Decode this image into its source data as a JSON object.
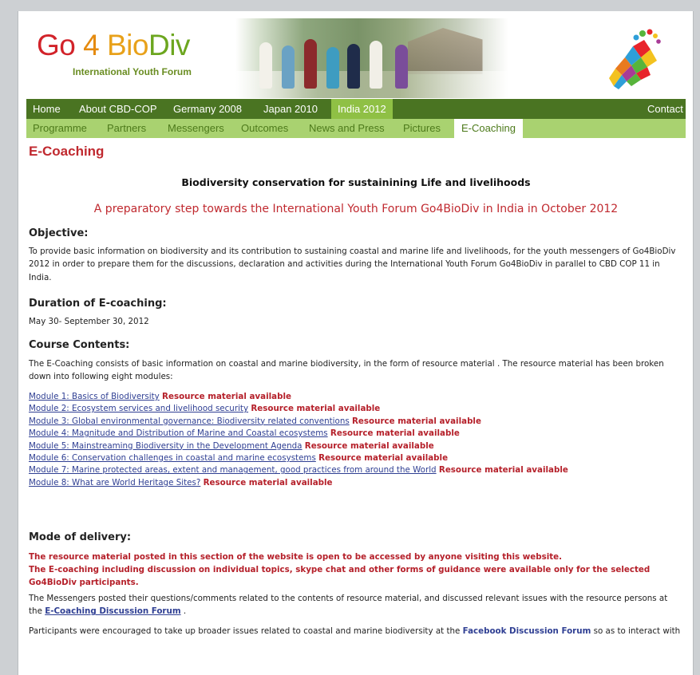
{
  "header": {
    "logo": {
      "go": "Go",
      "four": "4",
      "bio": "Bio",
      "div": "Div"
    },
    "tagline": "International Youth Forum"
  },
  "nav_primary": [
    {
      "label": "Home"
    },
    {
      "label": "About CBD-COP"
    },
    {
      "label": "Germany 2008"
    },
    {
      "label": "Japan 2010"
    },
    {
      "label": "India 2012",
      "active": true
    },
    {
      "label": "Contact"
    }
  ],
  "nav_secondary": [
    {
      "label": "Programme"
    },
    {
      "label": "Partners"
    },
    {
      "label": "Messengers"
    },
    {
      "label": "Outcomes"
    },
    {
      "label": "News and Press"
    },
    {
      "label": "Pictures"
    },
    {
      "label": "E-Coaching",
      "active": true
    }
  ],
  "content": {
    "title": "E-Coaching",
    "subtitle": "Biodiversity conservation for sustainining Life and livelihoods",
    "tagline": "A preparatory step towards the International Youth Forum Go4BioDiv in India in October 2012",
    "objective_heading": "Objective:",
    "objective_text": "To provide basic information on biodiversity and its contribution to sustaining coastal and marine life and livelihoods, for the youth messengers of Go4BioDiv 2012 in order to prepare them for the discussions, declaration and activities during the International Youth Forum Go4BioDiv in parallel to CBD COP 11 in India.",
    "duration_heading": "Duration of E-coaching:",
    "duration_text": "May 30- September 30, 2012",
    "course_heading": "Course Contents:",
    "course_text": "The E-Coaching consists of basic information on coastal and marine biodiversity, in the form of resource material . The resource material has been broken down into following eight modules:",
    "modules": [
      {
        "link": "Module 1: Basics of Biodiversity",
        "status": "Resource material available"
      },
      {
        "link": "Module 2: Ecosystem services and livelihood security",
        "status": "Resource material available"
      },
      {
        "link": "Module 3: Global environmental governance: Biodiversity related conventions",
        "status": "Resource material available"
      },
      {
        "link": "Module 4: Magnitude and Distribution of Marine and Coastal ecosystems",
        "status": "Resource material available"
      },
      {
        "link": "Module 5: Mainstreaming Biodiversity in the Development Agenda",
        "status": "Resource material available"
      },
      {
        "link": "Module 6: Conservation challenges in coastal and marine ecosystems",
        "status": "Resource material available"
      },
      {
        "link": "Module 7: Marine protected areas, extent and management, good practices from around the World",
        "status": "Resource material available"
      },
      {
        "link": "Module 8: What are World Heritage Sites?",
        "status": "Resource material available"
      }
    ],
    "delivery_heading": "Mode of delivery:",
    "delivery_note_1": "The resource material posted in this section of the website is open to be accessed by anyone visiting this website.",
    "delivery_note_2": "The E-coaching including discussion on individual topics, skype chat and other forms of guidance were available only for the selected Go4BioDiv participants.",
    "delivery_text_before": "The Messengers posted their questions/comments related to the contents of resource material, and discussed relevant issues with the resource persons at the",
    "delivery_link": "E-Coaching Discussion Forum",
    "delivery_text_after": " .",
    "participants_before": "Participants were encouraged to take up broader issues related to coastal and marine biodiversity at the",
    "participants_link": "Facebook Discussion Forum",
    "participants_after": " so as to interact with"
  },
  "colors": {
    "nav_dark": "#4a7422",
    "nav_light": "#a9d270",
    "accent_red": "#c0292f",
    "link_blue": "#2f3f93"
  }
}
